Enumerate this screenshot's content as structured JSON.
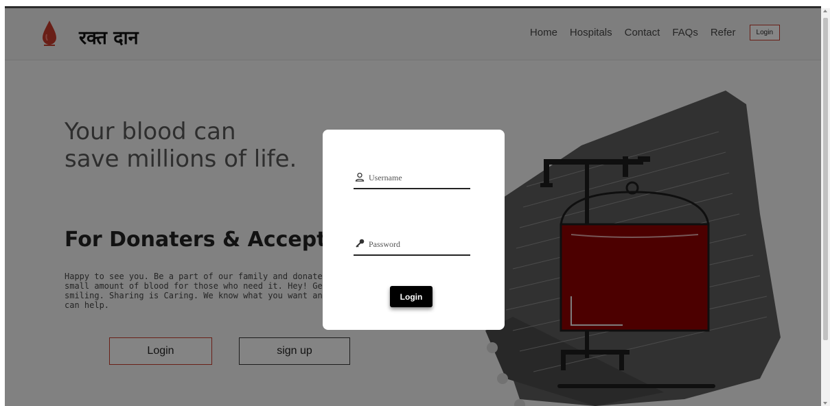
{
  "header": {
    "brand": "रक्त दान",
    "nav": [
      "Home",
      "Hospitals",
      "Contact",
      "FAQs",
      "Refer"
    ],
    "login_label": "Login",
    "logo_icon": "blood-drop-icon"
  },
  "hero": {
    "title": "Your blood can\nsave millions of life.",
    "section_title": "For Donaters & Acceptors",
    "description": "Happy to see you. Be a part of our family and donate a small amount of blood for those who need it. Hey! Get smiling. Sharing is Caring. We know what you want and we can help.",
    "login_label": "Login",
    "signup_label": "sign up"
  },
  "modal": {
    "username_placeholder": "Username",
    "password_placeholder": "Password",
    "login_label": "Login",
    "username_icon": "user-icon",
    "password_icon": "key-icon"
  },
  "colors": {
    "accent": "#c0392b",
    "blood": "#8b0000",
    "navbar": "#e6e6e6"
  }
}
